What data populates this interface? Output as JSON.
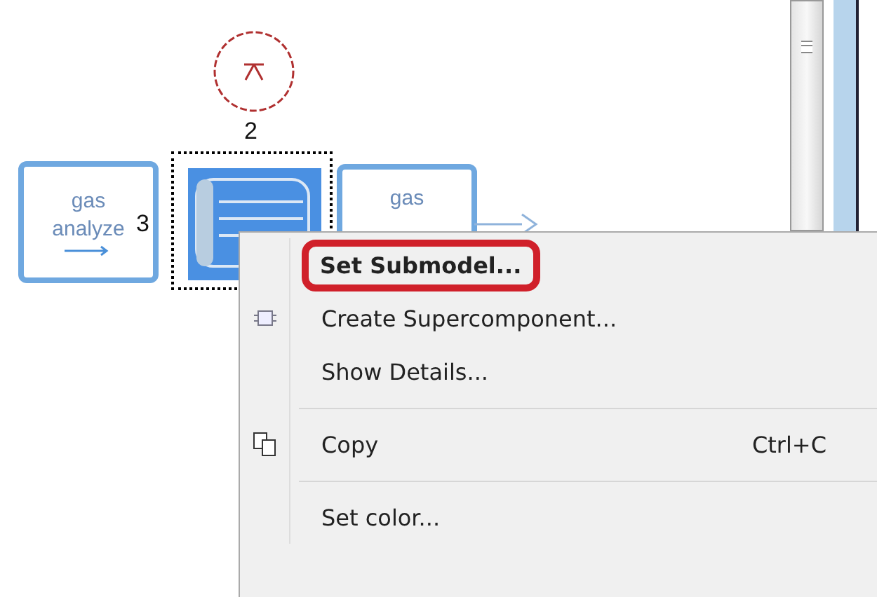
{
  "diagram": {
    "blocks": [
      {
        "kind": "text-block",
        "lines": [
          "gas",
          "analyze"
        ],
        "selected": false
      },
      {
        "kind": "heat-exchanger",
        "selected": true
      },
      {
        "kind": "text-block",
        "lines": [
          "gas"
        ],
        "selected": false
      }
    ],
    "port_labels": [
      "2",
      "3"
    ]
  },
  "context_menu": {
    "items": [
      {
        "kind": "item",
        "label": "Set Submodel...",
        "bold": true,
        "circled": true
      },
      {
        "kind": "item",
        "label": "Create Supercomponent...",
        "bold": false,
        "circled": false
      },
      {
        "kind": "item",
        "label": "Show Details...",
        "bold": false,
        "circled": false
      },
      {
        "kind": "separator"
      },
      {
        "kind": "item",
        "label": "Copy",
        "bold": false,
        "circled": false,
        "shortcut": "Ctrl+C"
      },
      {
        "kind": "separator"
      },
      {
        "kind": "item",
        "label": "Set color...",
        "bold": false,
        "circled": false
      }
    ]
  }
}
